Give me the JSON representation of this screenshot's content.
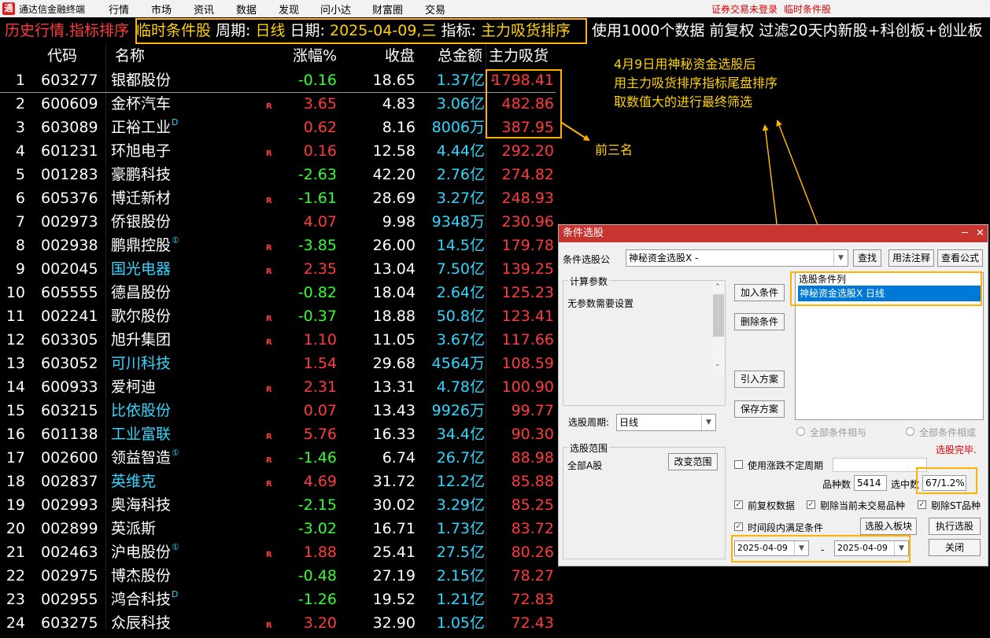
{
  "menubar": {
    "app_title": "通达信金融终端",
    "logo_char": "通",
    "items": [
      "行情",
      "市场",
      "资讯",
      "数据",
      "发现",
      "问小达",
      "财富圈",
      "交易"
    ],
    "right_links": [
      "证券交易未登录",
      "临时条件股"
    ]
  },
  "infobar": {
    "history": "历史行情.指标排序",
    "cond_label": "临时条件股",
    "period_label": " 周期: ",
    "period_value": "日线",
    "date_label": " 日期: ",
    "date_value": "2025-04-09,三",
    "indicator_label": " 指标: ",
    "indicator_value": "主力吸货排序",
    "rest": "使用1000个数据 前复权 过滤20天内新股+科创板+创业板"
  },
  "table": {
    "headers": {
      "code": "代码",
      "name": "名称",
      "pct": "涨幅%",
      "close": "收盘",
      "amount": "总金额",
      "main": "主力吸货",
      "sort_arrow": "↓"
    },
    "rows": [
      {
        "no": "1",
        "code": "603277",
        "name": "银都股份",
        "mark": "",
        "r": "",
        "pct": "-0.16",
        "close": "18.65",
        "amount": "1.37亿",
        "main": "1798.41",
        "cyan": false
      },
      {
        "no": "2",
        "code": "600609",
        "name": "金杯汽车",
        "mark": "",
        "r": "R",
        "pct": "3.65",
        "close": "4.83",
        "amount": "3.06亿",
        "main": "482.86",
        "cyan": false
      },
      {
        "no": "3",
        "code": "603089",
        "name": "正裕工业",
        "mark": "D",
        "r": "",
        "pct": "0.62",
        "close": "8.16",
        "amount": "8006万",
        "main": "387.95",
        "cyan": false
      },
      {
        "no": "4",
        "code": "601231",
        "name": "环旭电子",
        "mark": "",
        "r": "R",
        "pct": "0.16",
        "close": "12.58",
        "amount": "4.44亿",
        "main": "292.20",
        "cyan": false
      },
      {
        "no": "5",
        "code": "001283",
        "name": "豪鹏科技",
        "mark": "",
        "r": "",
        "pct": "-2.63",
        "close": "42.20",
        "amount": "2.76亿",
        "main": "274.82",
        "cyan": false
      },
      {
        "no": "6",
        "code": "605376",
        "name": "博迁新材",
        "mark": "",
        "r": "R",
        "pct": "-1.61",
        "close": "28.69",
        "amount": "3.27亿",
        "main": "248.93",
        "cyan": false
      },
      {
        "no": "7",
        "code": "002973",
        "name": "侨银股份",
        "mark": "",
        "r": "",
        "pct": "4.07",
        "close": "9.98",
        "amount": "9348万",
        "main": "230.96",
        "cyan": false
      },
      {
        "no": "8",
        "code": "002938",
        "name": "鹏鼎控股",
        "mark": "①",
        "r": "R",
        "pct": "-3.85",
        "close": "26.00",
        "amount": "14.5亿",
        "main": "179.78",
        "cyan": false
      },
      {
        "no": "9",
        "code": "002045",
        "name": "国光电器",
        "mark": "",
        "r": "R",
        "pct": "2.35",
        "close": "13.04",
        "amount": "7.50亿",
        "main": "139.25",
        "cyan": true
      },
      {
        "no": "10",
        "code": "605555",
        "name": "德昌股份",
        "mark": "",
        "r": "",
        "pct": "-0.82",
        "close": "18.04",
        "amount": "2.64亿",
        "main": "125.23",
        "cyan": false
      },
      {
        "no": "11",
        "code": "002241",
        "name": "歌尔股份",
        "mark": "",
        "r": "R",
        "pct": "-0.37",
        "close": "18.88",
        "amount": "50.8亿",
        "main": "123.41",
        "cyan": false
      },
      {
        "no": "12",
        "code": "603305",
        "name": "旭升集团",
        "mark": "",
        "r": "R",
        "pct": "1.10",
        "close": "11.05",
        "amount": "3.67亿",
        "main": "117.66",
        "cyan": false
      },
      {
        "no": "13",
        "code": "603052",
        "name": "可川科技",
        "mark": "",
        "r": "",
        "pct": "1.54",
        "close": "29.68",
        "amount": "4564万",
        "main": "108.59",
        "cyan": true
      },
      {
        "no": "14",
        "code": "600933",
        "name": "爱柯迪",
        "mark": "",
        "r": "R",
        "pct": "2.31",
        "close": "13.31",
        "amount": "4.78亿",
        "main": "100.90",
        "cyan": false
      },
      {
        "no": "15",
        "code": "603215",
        "name": "比依股份",
        "mark": "",
        "r": "",
        "pct": "0.07",
        "close": "13.43",
        "amount": "9926万",
        "main": "99.77",
        "cyan": true
      },
      {
        "no": "16",
        "code": "601138",
        "name": "工业富联",
        "mark": "",
        "r": "R",
        "pct": "5.76",
        "close": "16.33",
        "amount": "34.4亿",
        "main": "90.30",
        "cyan": true
      },
      {
        "no": "17",
        "code": "002600",
        "name": "领益智造",
        "mark": "①",
        "r": "R",
        "pct": "-1.46",
        "close": "6.74",
        "amount": "26.7亿",
        "main": "88.98",
        "cyan": false
      },
      {
        "no": "18",
        "code": "002837",
        "name": "英维克",
        "mark": "",
        "r": "R",
        "pct": "4.69",
        "close": "31.72",
        "amount": "12.2亿",
        "main": "85.88",
        "cyan": true
      },
      {
        "no": "19",
        "code": "002993",
        "name": "奥海科技",
        "mark": "",
        "r": "",
        "pct": "-2.15",
        "close": "30.02",
        "amount": "3.29亿",
        "main": "85.25",
        "cyan": false
      },
      {
        "no": "20",
        "code": "002899",
        "name": "英派斯",
        "mark": "",
        "r": "",
        "pct": "-3.02",
        "close": "16.71",
        "amount": "1.73亿",
        "main": "83.72",
        "cyan": false
      },
      {
        "no": "21",
        "code": "002463",
        "name": "沪电股份",
        "mark": "①",
        "r": "R",
        "pct": "1.88",
        "close": "25.41",
        "amount": "27.5亿",
        "main": "80.26",
        "cyan": false
      },
      {
        "no": "22",
        "code": "002975",
        "name": "博杰股份",
        "mark": "",
        "r": "",
        "pct": "-0.48",
        "close": "27.19",
        "amount": "2.15亿",
        "main": "78.27",
        "cyan": false
      },
      {
        "no": "23",
        "code": "002955",
        "name": "鸿合科技",
        "mark": "D",
        "r": "",
        "pct": "-1.26",
        "close": "19.52",
        "amount": "1.21亿",
        "main": "72.83",
        "cyan": false
      },
      {
        "no": "24",
        "code": "603275",
        "name": "众辰科技",
        "mark": "",
        "r": "R",
        "pct": "3.20",
        "close": "32.90",
        "amount": "1.05亿",
        "main": "72.43",
        "cyan": false
      }
    ]
  },
  "annotations": {
    "note_line1": "4月9日用神秘资金选股后",
    "note_line2": "用主力吸货排序指标尾盘排序",
    "note_line3": "取数值大的进行最终筛选",
    "top3": "前三名"
  },
  "dialog": {
    "title": "条件选股",
    "min_glyph": "─",
    "close_glyph": "✕",
    "formula_label": "条件选股公",
    "formula_value": "神秘资金选股X  -",
    "btn_find": "查找",
    "btn_usage": "用法注释",
    "btn_view": "查看公式",
    "params_title": "计算参数",
    "params_text": "无参数需要设置",
    "btn_add": "加入条件",
    "btn_delete": "删除条件",
    "btn_import": "引入方案",
    "btn_save": "保存方案",
    "cond_list_title": "选股条件列",
    "cond_list_item": "神秘资金选股X  日线",
    "period_label": "选股周期:",
    "period_value": "日线",
    "radio_and": "全部条件相与",
    "radio_or": "全部条件相或",
    "status": "选股完毕.",
    "range_title": "选股范围",
    "range_value": "全部A股",
    "btn_change_range": "改变范围",
    "chk_variable_period": "使用涨跌不定周期",
    "count_label": "品种数",
    "count_value": "5414",
    "selected_label": "选中数",
    "selected_value": "67/1.2%",
    "chk_adjust": "前复权数据",
    "chk_exclude_untraded": "剔除当前未交易品种",
    "chk_exclude_st": "剔除ST品种",
    "chk_time_range": "时间段内满足条件",
    "btn_to_block": "选股入板块",
    "btn_execute": "执行选股",
    "date_from": "2025-04-09",
    "date_sep": "-",
    "date_to": "2025-04-09",
    "btn_close": "关闭"
  },
  "colors": {
    "up": "#ff3b3b",
    "down": "#33ff33",
    "amount": "#2fd8ff",
    "highlight": "#ffb300",
    "annotation": "#ffd200",
    "dialog_title": "#c8342f"
  }
}
